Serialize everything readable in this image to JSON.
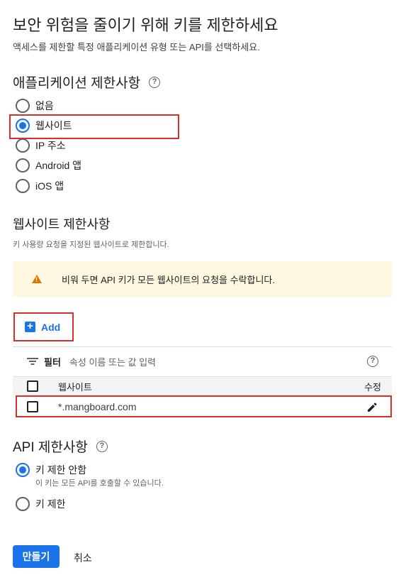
{
  "header": {
    "title": "보안 위험을 줄이기 위해 키를 제한하세요",
    "subtitle": "액세스를 제한할 특정 애플리케이션 유형 또는 API를 선택하세요."
  },
  "app_restrictions": {
    "heading": "애플리케이션 제한사항",
    "help_icon": "help-circle-icon",
    "options": [
      {
        "label": "없음",
        "selected": false
      },
      {
        "label": "웹사이트",
        "selected": true
      },
      {
        "label": "IP 주소",
        "selected": false
      },
      {
        "label": "Android 앱",
        "selected": false
      },
      {
        "label": "iOS 앱",
        "selected": false
      }
    ]
  },
  "website_restrictions": {
    "heading": "웹사이트 제한사항",
    "description": "키 사용량 요청을 지정된 웹사이트로 제한합니다.",
    "warning": "비워 두면 API 키가 모든 웹사이트의 요청을 수락합니다.",
    "add_label": "Add",
    "filter_label": "필터",
    "filter_placeholder": "속성 이름 또는 값 입력",
    "columns": {
      "site": "웹사이트",
      "edit": "수정"
    },
    "rows": [
      {
        "site": "*.mangboard.com"
      }
    ]
  },
  "api_restrictions": {
    "heading": "API 제한사항",
    "options": [
      {
        "label": "키 제한 안함",
        "sublabel": "이 키는 모든 API를 호출할 수 있습니다.",
        "selected": true
      },
      {
        "label": "키 제한",
        "selected": false
      }
    ]
  },
  "actions": {
    "create_label": "만들기",
    "cancel_label": "취소"
  },
  "colors": {
    "accent": "#1a73e8",
    "highlight_border": "#d93025",
    "warning_bg": "#fef7e0",
    "warning_icon": "#e37400"
  }
}
